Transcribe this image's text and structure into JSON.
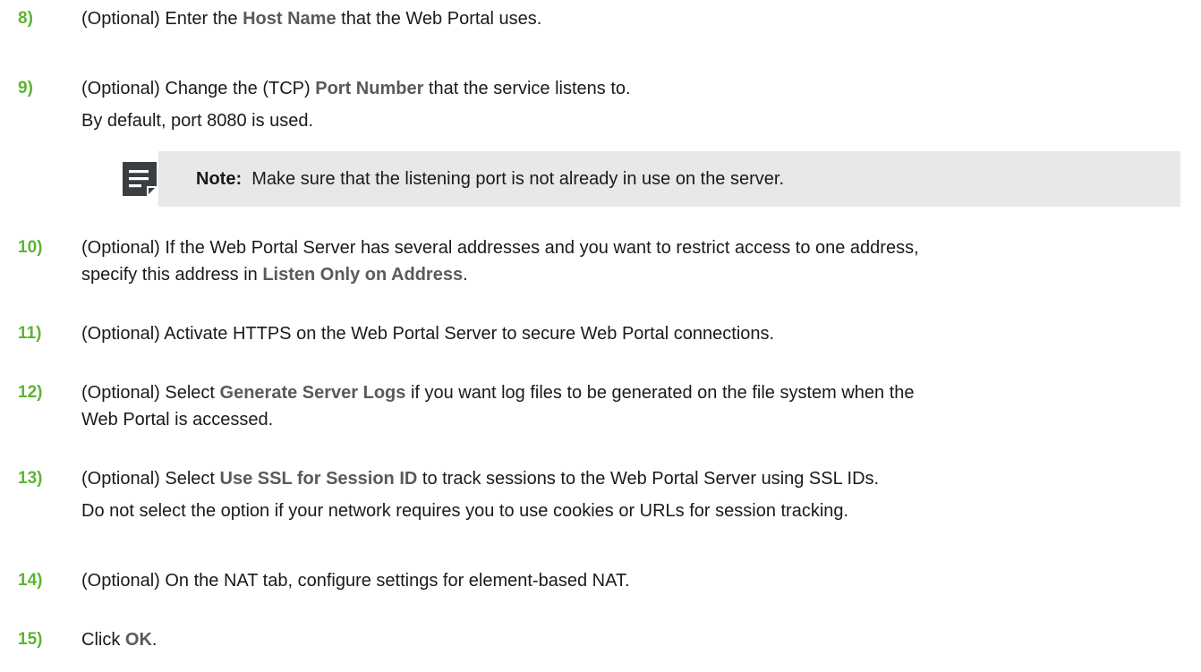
{
  "steps": [
    {
      "number": "8)",
      "lines": [
        {
          "before": "(Optional) Enter the ",
          "ui": "Host Name",
          "after": " that the Web Portal uses."
        }
      ]
    },
    {
      "number": "9)",
      "lines": [
        {
          "before": "(Optional) Change the (TCP) ",
          "ui": "Port Number",
          "after": " that the service listens to."
        },
        {
          "text": "By default, port 8080 is used."
        }
      ]
    },
    {
      "number": "10)",
      "lines": [
        {
          "text": "(Optional) If the Web Portal Server has several addresses and you want to restrict access to one address,"
        },
        {
          "before": "specify this address in ",
          "ui": "Listen Only on Address",
          "after": "."
        }
      ]
    },
    {
      "number": "11)",
      "lines": [
        {
          "text": "(Optional) Activate HTTPS on the Web Portal Server to secure Web Portal connections."
        }
      ]
    },
    {
      "number": "12)",
      "lines": [
        {
          "before": "(Optional) Select ",
          "ui": "Generate Server Logs",
          "after": " if you want log files to be generated on the file system when the"
        },
        {
          "text": "Web Portal is accessed."
        }
      ]
    },
    {
      "number": "13)",
      "lines": [
        {
          "before": "(Optional) Select ",
          "ui": "Use SSL for Session ID",
          "after": " to track sessions to the Web Portal Server using SSL IDs."
        },
        {
          "text": "Do not select the option if your network requires you to use cookies or URLs for session tracking."
        }
      ]
    },
    {
      "number": "14)",
      "lines": [
        {
          "text": "(Optional) On the NAT tab, configure settings for element-based NAT."
        }
      ]
    },
    {
      "number": "15)",
      "lines": [
        {
          "before": "Click ",
          "ui": "OK",
          "after": "."
        }
      ]
    }
  ],
  "note": {
    "label": "Note:",
    "text": "Make sure that the listening port is not already in use on the server.",
    "icon": "note-icon"
  },
  "colors": {
    "step_number": "#5cb531",
    "ui_term": "#5a5a5a",
    "note_background": "#e8e8e8",
    "note_icon": "#3a3f44"
  }
}
